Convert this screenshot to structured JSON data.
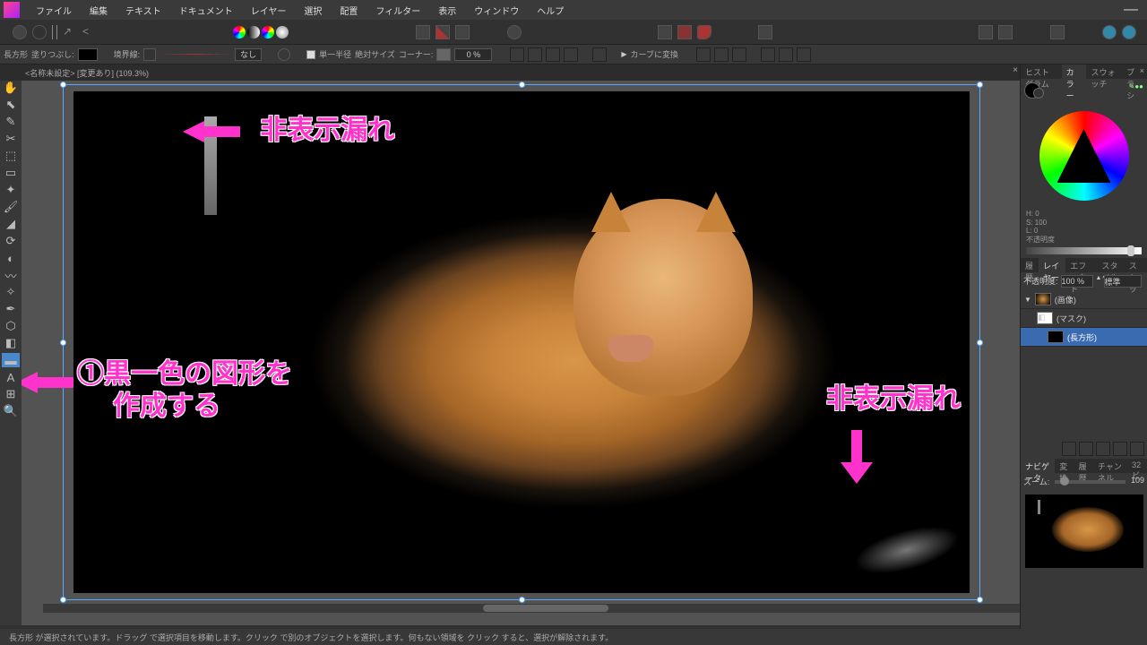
{
  "menubar": {
    "items": [
      "ファイル",
      "編集",
      "テキスト",
      "ドキュメント",
      "レイヤー",
      "選択",
      "配置",
      "フィルター",
      "表示",
      "ウィンドウ",
      "ヘルプ"
    ]
  },
  "context_toolbar": {
    "shape_label": "長方形",
    "fill_label": "塗りつぶし:",
    "stroke_label": "境界線:",
    "stroke_style": "なし",
    "single_radius_label": "単一半径",
    "abs_size_label": "絶対サイズ",
    "corner_label": "コーナー:",
    "corner_value": "0 %",
    "curve_btn": "カーブに変換"
  },
  "doc_tab": "<名称未設定> [変更あり] (109.3%)",
  "annotations": {
    "a1": "非表示漏れ",
    "a2_l1": "①黒一色の図形を",
    "a2_l2": "作成する",
    "a3": "非表示漏れ"
  },
  "statusbar": "長方形 が選択されています。ドラッグ で選択項目を移動します。クリック で別のオブジェクトを選択します。何もない領域を クリック すると、選択が解除されます。",
  "right": {
    "panel1_tabs": [
      "ヒストグラム",
      "カラー",
      "スウォッチ",
      "ブラシ"
    ],
    "hsl": {
      "h": "H: 0",
      "s": "S: 100",
      "l": "L: 0"
    },
    "opacity_label": "不透明度",
    "opacity_value": "100",
    "panel2_tabs": [
      "履歴",
      "レイヤー",
      "エフェクト",
      "スタイル",
      "ストッ"
    ],
    "layers_opacity_label": "不透明度:",
    "layers_opacity_value": "100 %",
    "layers_blend": "標準",
    "layers": {
      "image": "(画像)",
      "mask": "(マスク)",
      "rect": "(長方形)"
    },
    "panel3_tabs": [
      "ナビゲータ",
      "変換",
      "履歴",
      "チャンネル",
      "32ビ"
    ],
    "zoom_label": "ズーム:",
    "zoom_value": "109"
  }
}
